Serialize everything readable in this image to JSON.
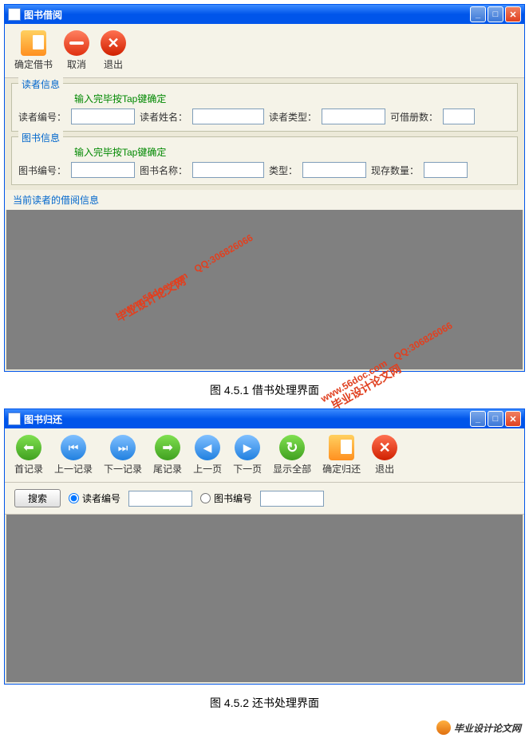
{
  "window1": {
    "title": "图书借阅",
    "toolbar": {
      "confirm": "确定借书",
      "cancel": "取消",
      "exit": "退出"
    },
    "reader_section": {
      "legend": "读者信息",
      "hint": "输入完毕按Tap键确定",
      "id_label": "读者编号：",
      "name_label": "读者姓名：",
      "type_label": "读者类型：",
      "limit_label": "可借册数：",
      "id_val": "",
      "name_val": "",
      "type_val": "",
      "limit_val": ""
    },
    "book_section": {
      "legend": "图书信息",
      "hint": "输入完毕按Tap键确定",
      "id_label": "图书编号：",
      "name_label": "图书名称：",
      "type_label": "类型：",
      "stock_label": "现存数量：",
      "id_val": "",
      "name_val": "",
      "type_val": "",
      "stock_val": ""
    },
    "borrow_section_label": "当前读者的借阅信息"
  },
  "caption1": "图 4.5.1 借书处理界面",
  "window2": {
    "title": "图书归还",
    "toolbar": {
      "first": "首记录",
      "prev": "上一记录",
      "next": "下一记录",
      "last": "尾记录",
      "pgup": "上一页",
      "pgdn": "下一页",
      "showall": "显示全部",
      "confirm": "确定归还",
      "exit": "退出"
    },
    "search": {
      "btn": "搜索",
      "by_reader": "读者编号",
      "by_book": "图书编号",
      "reader_val": "",
      "book_val": ""
    }
  },
  "caption2": "图 4.5.2 还书处理界面",
  "watermark": {
    "site": "www.56doc.com",
    "qq": "QQ:306826066",
    "brand": "毕业设计论文网"
  }
}
